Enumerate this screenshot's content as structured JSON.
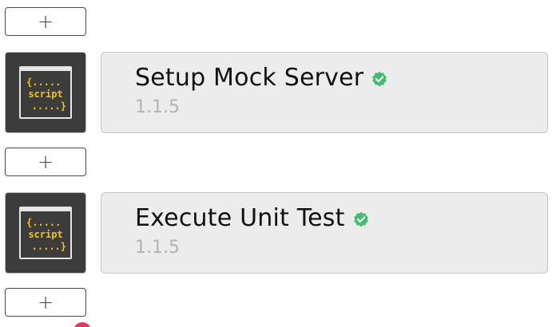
{
  "workflow": {
    "add_step_label": "+",
    "steps": [
      {
        "icon_text": [
          "{.....",
          "script",
          ".....}"
        ],
        "title": "Setup Mock Server",
        "version": "1.1.5",
        "verified": true
      },
      {
        "icon_text": [
          "{.....",
          "script",
          ".....}"
        ],
        "title": "Execute Unit Test",
        "version": "1.1.5",
        "verified": true
      }
    ]
  },
  "colors": {
    "icon_background": "#3c3c3c",
    "script_text": "#f0c419",
    "card_background": "#ececec",
    "verified_badge": "#3fbf6f",
    "version_text": "#b3b3b3",
    "alert_dot": "#e8365d"
  },
  "icons": {
    "step_icon": "script-icon",
    "verified_icon": "verified-badge-icon",
    "add_icon": "plus-icon"
  }
}
